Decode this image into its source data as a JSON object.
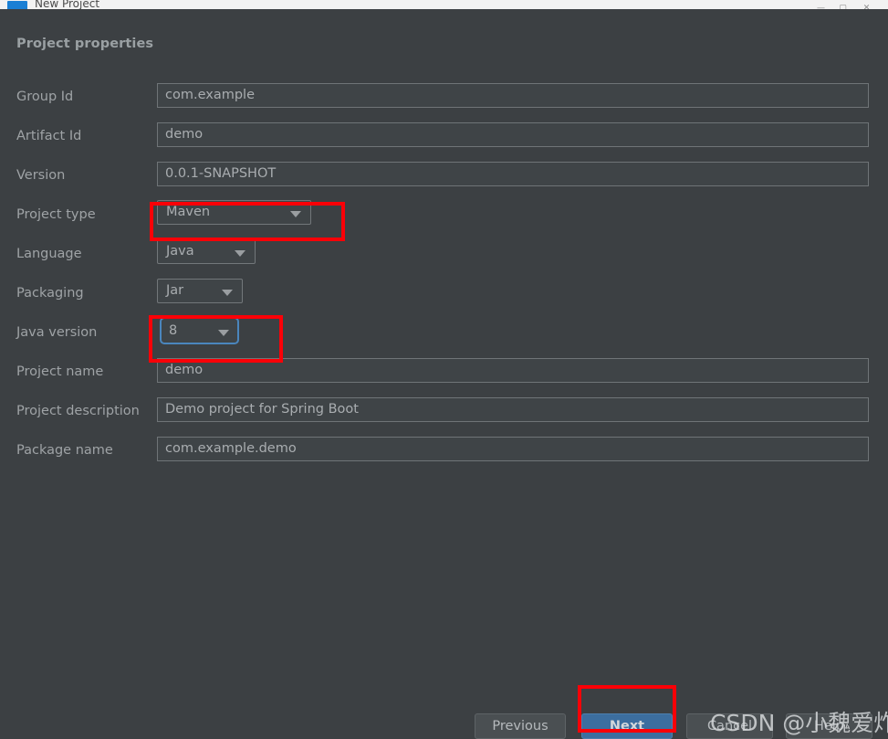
{
  "window": {
    "title": "New Project",
    "app_icon": "intellij-logo-icon",
    "controls": {
      "minimize": "—",
      "maximize": "▢",
      "close": "✕"
    }
  },
  "dialog": {
    "heading": "Project properties",
    "fields": [
      {
        "label": "Group Id",
        "value": "com.example",
        "kind": "text"
      },
      {
        "label": "Artifact Id",
        "value": "demo",
        "kind": "text"
      },
      {
        "label": "Version",
        "value": "0.0.1-SNAPSHOT",
        "kind": "text"
      },
      {
        "label": "Project type",
        "value": "Maven",
        "kind": "combo"
      },
      {
        "label": "Language",
        "value": "Java",
        "kind": "combo"
      },
      {
        "label": "Packaging",
        "value": "Jar",
        "kind": "combo"
      },
      {
        "label": "Java version",
        "value": "8",
        "kind": "combo"
      },
      {
        "label": "Project name",
        "value": "demo",
        "kind": "text"
      },
      {
        "label": "Project description",
        "value": "Demo project for Spring Boot",
        "kind": "text"
      },
      {
        "label": "Package name",
        "value": "com.example.demo",
        "kind": "text"
      }
    ],
    "dropdown_arrow_icon": "chevron-down-icon"
  },
  "footer": {
    "previous_label": "Previous",
    "next_label": "Next",
    "cancel_label": "Cancel",
    "help_label": "Help"
  },
  "annotations": {
    "color": "#fb0007",
    "targets": [
      "project-type",
      "java-version",
      "next-button"
    ]
  },
  "watermark": {
    "text": "CSDN @小魏爱炸毛"
  },
  "colors": {
    "dialog_background": "#3c4043",
    "input_background": "#3f4447",
    "input_border": "#6f7477",
    "text": "#a9adb0",
    "label": "#9fa3a6",
    "primary_button": "#3c6e9f",
    "focus_ring": "#4a86bd",
    "annotation_red": "#fb0007",
    "titlebar": "#f2f2f2"
  }
}
